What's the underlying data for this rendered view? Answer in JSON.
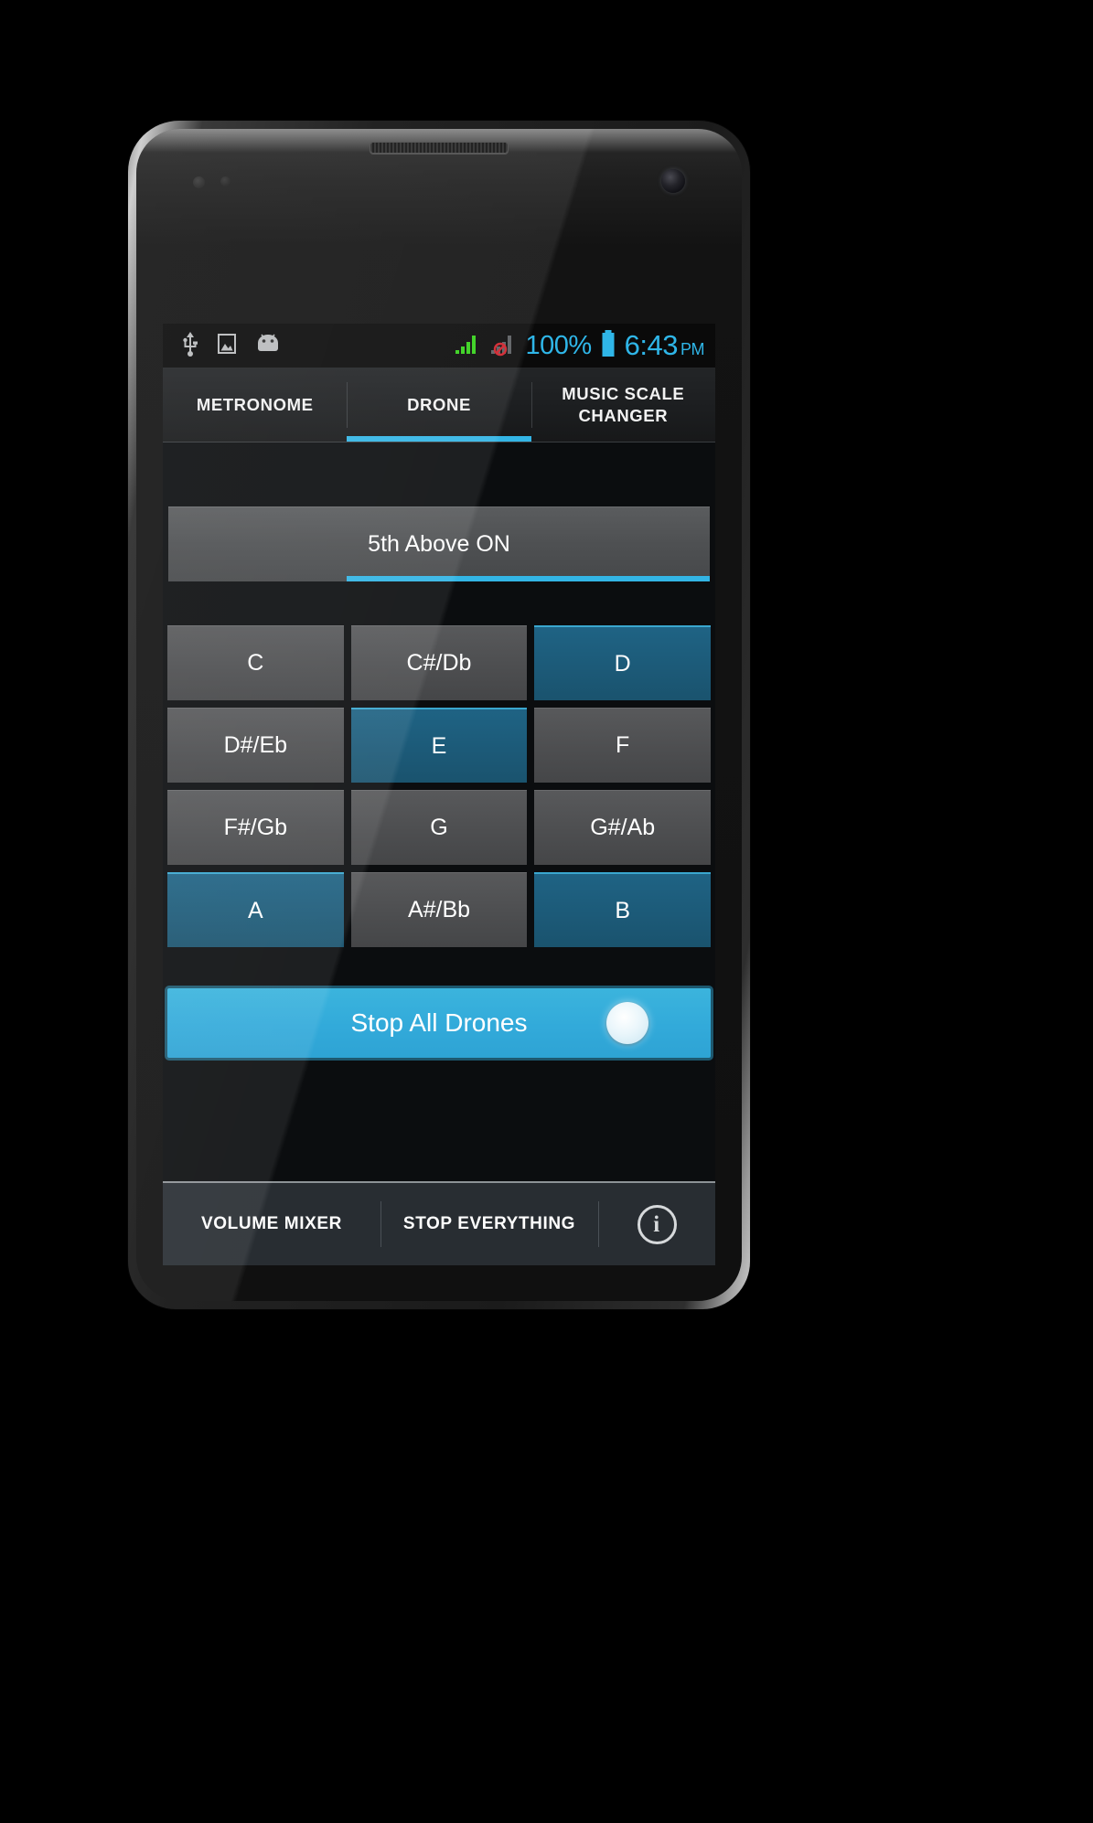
{
  "status_bar": {
    "icons_left": [
      "usb-icon",
      "screenshot-image-icon",
      "android-robot-icon"
    ],
    "signal_icon": "signal-bars-icon",
    "signal_secondary_icon": "signal-no-service-icon",
    "battery_percent": "100%",
    "battery_icon": "battery-full-icon",
    "time": "6:43",
    "meridiem": "PM",
    "accent_color": "#2fb6e8"
  },
  "tabs": [
    {
      "label": "METRONOME",
      "active": false
    },
    {
      "label": "DRONE",
      "active": true
    },
    {
      "label": "MUSIC SCALE CHANGER",
      "active": false
    }
  ],
  "main": {
    "fifth_toggle": {
      "label": "5th Above ON",
      "underline_color": "#33b5e5"
    },
    "notes": [
      {
        "label": "C",
        "on": false
      },
      {
        "label": "C#/Db",
        "on": false
      },
      {
        "label": "D",
        "on": true
      },
      {
        "label": "D#/Eb",
        "on": false
      },
      {
        "label": "E",
        "on": true
      },
      {
        "label": "F",
        "on": false
      },
      {
        "label": "F#/Gb",
        "on": false
      },
      {
        "label": "G",
        "on": false
      },
      {
        "label": "G#/Ab",
        "on": false
      },
      {
        "label": "A",
        "on": true
      },
      {
        "label": "A#/Bb",
        "on": false
      },
      {
        "label": "B",
        "on": true
      }
    ],
    "stop_all": {
      "label": "Stop All Drones",
      "color": "#32aada",
      "knob": "toggle-knob"
    }
  },
  "bottom_bar": {
    "volume_mixer": "VOLUME MIXER",
    "stop_everything": "STOP EVERYTHING",
    "info_glyph": "i"
  },
  "colors": {
    "accent": "#33b5e5",
    "selected_note": "#1c5a78",
    "unselected_note": "#4d4e50",
    "screen_bg": "#0b0d0f"
  }
}
